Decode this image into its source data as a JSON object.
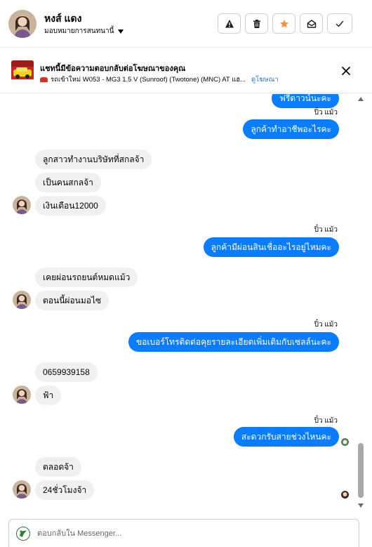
{
  "header": {
    "contact_name": "หงส์ แดง",
    "assign_label": "มอบหมายการสนทนานี้",
    "actions": [
      "report-spam",
      "delete",
      "star",
      "mark-unread",
      "mark-done"
    ]
  },
  "ad": {
    "title": "แชทนี้มีข้อความตอบกลับต่อโฆษณาของคุณ",
    "subtitle": "รถเข้าใหม่ W053 - MG3 1.5 V (Sunroof) (Twotone) (MNC) AT แฮ...",
    "link": "ดูโฆษณา"
  },
  "conversation": [
    {
      "dir": "out",
      "text": "ฟรีดาวน์นะคะ",
      "sender": ""
    },
    {
      "dir": "out",
      "text": "ลูกค้าทำอาชีพอะไรคะ",
      "sender": "ปิ๋ว แม้ว"
    },
    {
      "dir": "in",
      "text": "ลูกสาวทำงานบริษัทที่สกลจ้า"
    },
    {
      "dir": "in",
      "text": "เป็นคนสกลจ้า"
    },
    {
      "dir": "in",
      "text": "เงินเดือน12000"
    },
    {
      "dir": "out",
      "text": "ลูกค้ามีผ่อนสินเชื่ออะไรอยู่ไหมคะ",
      "sender": "ปิ๋ว แม้ว"
    },
    {
      "dir": "in",
      "text": "เคยผ่อนรถยนต์หมดแม้ว"
    },
    {
      "dir": "in",
      "text": "ตอนนี้ผ่อนมอไซ"
    },
    {
      "dir": "out",
      "text": "ขอเบอร์โทรติดต่อคุยรายละเอียดเพิ่มเติมกับเซลล์นะคะ",
      "sender": "ปิ๋ว แม้ว"
    },
    {
      "dir": "in",
      "text": "0659939158"
    },
    {
      "dir": "in",
      "text": "ฟ้า"
    },
    {
      "dir": "out",
      "text": "สะดวกรับสายช่วงไหนคะ",
      "sender": "ปิ๋ว แม้ว"
    },
    {
      "dir": "in",
      "text": "ตลอดจ้า"
    },
    {
      "dir": "in",
      "text": "24ชั่วโมงจ้า"
    }
  ],
  "composer": {
    "placeholder": "ตอบกลับใน Messenger..."
  },
  "colors": {
    "outgoing_bubble": "#0a7cff",
    "incoming_bubble": "#f0f0f0",
    "star_accent": "#f7923b",
    "link": "#1877f2"
  }
}
